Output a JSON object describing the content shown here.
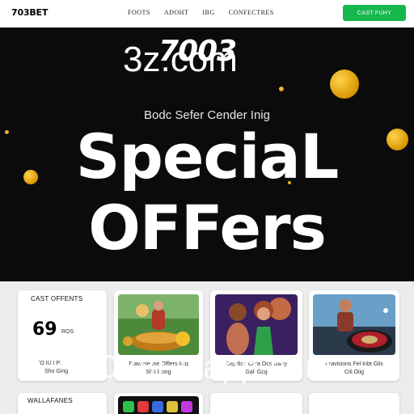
{
  "header": {
    "logo": "703BET",
    "nav": [
      "FOOTS",
      "ADOHT",
      "IBG",
      "CONFECTRES"
    ],
    "cta": "CAST FUHY"
  },
  "hero": {
    "watermark": "3z.com",
    "logo": "7003",
    "subtitle": "Bodc Sefer Cender Inig",
    "headline_line1": "SpeciaL",
    "headline_line2": "OFFers"
  },
  "cards": {
    "card1": {
      "title": "CAST OFFENTS",
      "big": "69",
      "big_suffix": "ROS",
      "line1": "'O IU I P.",
      "line2": "Sho Ging"
    },
    "card2": {
      "caption1": "Fravisse Ine Olflers Iqig",
      "caption2": "Shit lnong"
    },
    "card3": {
      "caption1": "Cepdice Chra Ocs Gaay",
      "caption2": "Gall Gcg"
    },
    "card4": {
      "caption1": "Pravisions Fel Inbt Glis",
      "caption2": "Cili Oiig"
    },
    "card5": {
      "title": "WALLAFANES"
    }
  },
  "watermark_bottom": "7038ERapp.com",
  "colors": {
    "accent": "#16b84e",
    "coin": "#e0a400",
    "hero_bg": "#0b0b0c"
  }
}
